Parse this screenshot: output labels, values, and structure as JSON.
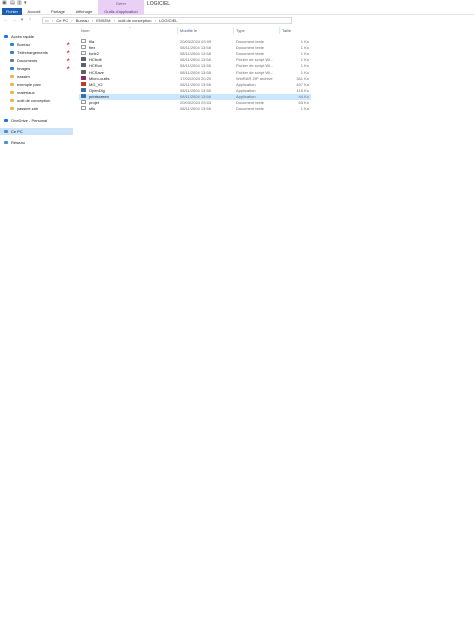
{
  "window": {
    "title": "LOGICIEL",
    "manage_group": "Gérer"
  },
  "ribbon": {
    "tabs": [
      "Fichier",
      "Accueil",
      "Partage",
      "Affichage",
      "Outils d'application"
    ]
  },
  "address": {
    "crumbs": [
      "Ce PC",
      "Bureau",
      "ENSEM",
      "outil de conception",
      "LOGICIEL"
    ]
  },
  "sidebar": {
    "items": [
      {
        "label": "Accès rapide",
        "icon": "star-icon",
        "color": "#1a73e8",
        "pinned": false
      },
      {
        "label": "Bureau",
        "icon": "desktop-icon",
        "color": "#2f7fd1",
        "pinned": true
      },
      {
        "label": "Téléchargements",
        "icon": "download-icon",
        "color": "#2f7fd1",
        "pinned": true
      },
      {
        "label": "Documents",
        "icon": "document-icon",
        "color": "#6b7a8c",
        "pinned": true
      },
      {
        "label": "Images",
        "icon": "picture-icon",
        "color": "#2f7fd1",
        "pinned": true
      },
      {
        "label": "nassim",
        "icon": "folder-icon",
        "color": "#e8b84a",
        "pinned": false
      },
      {
        "label": "exemple parc",
        "icon": "folder-icon",
        "color": "#e8b84a",
        "pinned": false
      },
      {
        "label": "materiaux",
        "icon": "folder-icon",
        "color": "#e8b84a",
        "pinned": false
      },
      {
        "label": "outil de conception",
        "icon": "folder-icon",
        "color": "#e8b84a",
        "pinned": false
      },
      {
        "label": "yassine zah",
        "icon": "folder-icon",
        "color": "#e8b84a",
        "pinned": false
      },
      {
        "label": "OneDrive - Personal",
        "icon": "cloud-icon",
        "color": "#1a73e8",
        "pinned": false
      },
      {
        "label": "Ce PC",
        "icon": "computer-icon",
        "color": "#4a90d9",
        "pinned": false
      },
      {
        "label": "Réseau",
        "icon": "network-icon",
        "color": "#4a90d9",
        "pinned": false
      }
    ]
  },
  "columns": {
    "name": "Nom",
    "date": "Modifié le",
    "type": "Type",
    "size": "Taille"
  },
  "files": [
    {
      "name": "fila",
      "date": "20/03/2024 03:09",
      "type": "Document texte",
      "size": "1 Ko",
      "icon": "txt"
    },
    {
      "name": "flex",
      "date": "08/11/2004 13:58",
      "type": "Document texte",
      "size": "1 Ko",
      "icon": "txt"
    },
    {
      "name": "forie2",
      "date": "08/11/2004 13:58",
      "type": "Document texte",
      "size": "1 Ko",
      "icon": "txt"
    },
    {
      "name": "HCfrott",
      "date": "08/11/2004 13:58",
      "type": "Fichier de script Wi...",
      "size": "1 Ko",
      "icon": "bat"
    },
    {
      "name": "HCRun",
      "date": "08/11/2004 13:58",
      "type": "Fichier de script Wi...",
      "size": "1 Ko",
      "icon": "bat"
    },
    {
      "name": "HCSave",
      "date": "08/11/2004 13:58",
      "type": "Fichier de script Wi...",
      "size": "1 Ko",
      "icon": "bat"
    },
    {
      "name": "Micro-outils",
      "date": "17/02/2024 20:20",
      "type": "WinRAR ZIP archive",
      "size": "341 Ko",
      "icon": "rar"
    },
    {
      "name": "MG_V2",
      "date": "08/11/2004 13:58",
      "type": "Application",
      "size": "497 Ko",
      "icon": "app2"
    },
    {
      "name": "OpenDlg",
      "date": "08/11/2004 13:58",
      "type": "Application",
      "size": "116 Ko",
      "icon": "exe"
    },
    {
      "name": "printscreen",
      "date": "08/11/2004 13:58",
      "type": "Application",
      "size": "44 Ko",
      "icon": "exe",
      "selected": true
    },
    {
      "name": "projet",
      "date": "20/03/2024 03:03",
      "type": "Document texte",
      "size": "63 Ko",
      "icon": "txt"
    },
    {
      "name": "sflu",
      "date": "08/11/2004 13:58",
      "type": "Document texte",
      "size": "1 Ko",
      "icon": "txt"
    }
  ]
}
